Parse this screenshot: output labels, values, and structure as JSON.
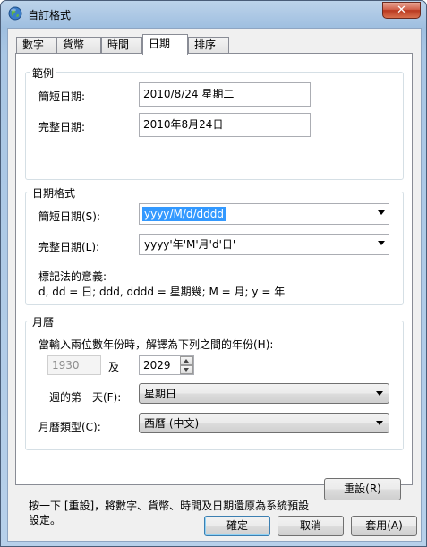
{
  "window": {
    "title": "自訂格式",
    "close_glyph": "✕"
  },
  "tabs": [
    {
      "label": "數字",
      "active": false
    },
    {
      "label": "貨幣",
      "active": false
    },
    {
      "label": "時間",
      "active": false
    },
    {
      "label": "日期",
      "active": true
    },
    {
      "label": "排序",
      "active": false
    }
  ],
  "example": {
    "group_title": "範例",
    "short_label": "簡短日期:",
    "short_value": "2010/8/24 星期二",
    "long_label": "完整日期:",
    "long_value": "2010年8月24日"
  },
  "date_formats": {
    "group_title": "日期格式",
    "short_label": "簡短日期(S):",
    "short_value": "yyyy/M/d/dddd",
    "long_label": "完整日期(L):",
    "long_value": "yyyy'年'M'月'd'日'",
    "notation_title": "標記法的意義:",
    "notation_text": "d, dd = 日; ddd, dddd = 星期幾; M = 月; y = 年"
  },
  "calendar": {
    "group_title": "月曆",
    "two_digit_label": "當輸入兩位數年份時，解譯為下列之間的年份(H):",
    "year_from": "1930",
    "and_label": "及",
    "year_to": "2029",
    "first_day_label": "一週的第一天(F):",
    "first_day_value": "星期日",
    "calendar_type_label": "月曆類型(C):",
    "calendar_type_value": "西曆 (中文)"
  },
  "footer": {
    "reset_note": "按一下 [重設]，將數字、貨幣、時間及日期還原為系統預設設定。",
    "reset_button": "重設(R)"
  },
  "buttons": {
    "ok": "確定",
    "cancel": "取消",
    "apply": "套用(A)"
  },
  "colors": {
    "selection": "#3399ff",
    "close_button": "#c94a32"
  }
}
